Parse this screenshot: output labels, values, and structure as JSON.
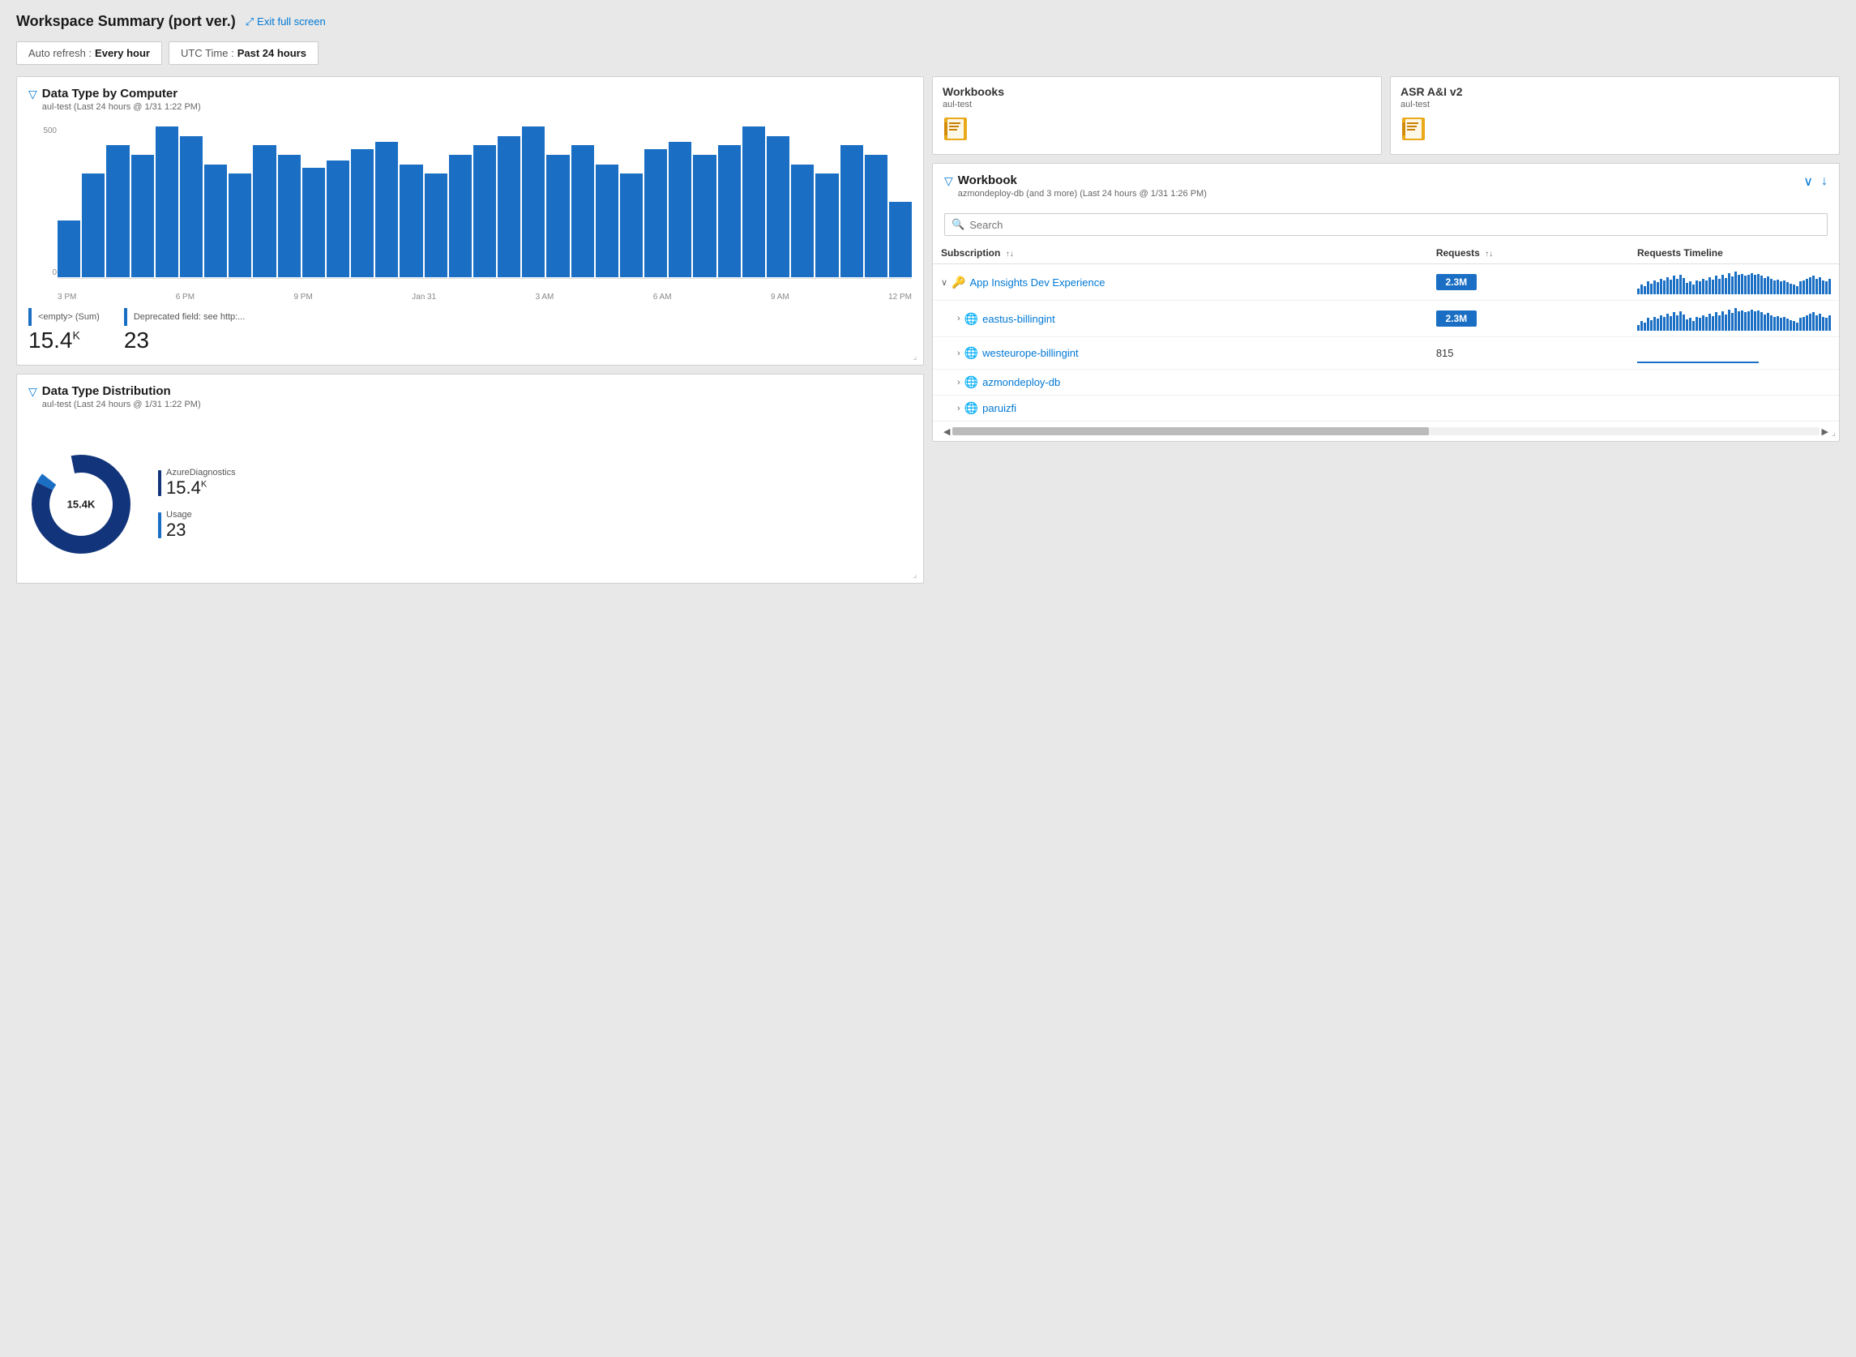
{
  "page": {
    "title": "Workspace Summary (port ver.)",
    "exit_fullscreen_label": "Exit full screen"
  },
  "toolbar": {
    "auto_refresh_label": "Auto refresh :",
    "auto_refresh_value": "Every hour",
    "time_label": "UTC Time :",
    "time_value": "Past 24 hours"
  },
  "data_type_by_computer": {
    "title": "Data Type by Computer",
    "subtitle": "aul-test (Last 24 hours @ 1/31 1:22 PM)",
    "y_labels": [
      "500",
      "0"
    ],
    "x_labels": [
      "3 PM",
      "6 PM",
      "9 PM",
      "Jan 31",
      "3 AM",
      "6 AM",
      "9 AM",
      "12 PM"
    ],
    "metric1_label": "<empty> (Sum)",
    "metric1_value": "15.4 K",
    "metric1_suffix": "K",
    "metric1_main": "15.4",
    "metric2_label": "Deprecated field: see http:...",
    "metric2_value": "23",
    "bar_heights": [
      30,
      55,
      70,
      65,
      80,
      75,
      60,
      55,
      70,
      65,
      58,
      62,
      68,
      72,
      60,
      55,
      65,
      70,
      75,
      80,
      65,
      70,
      60,
      55,
      68,
      72,
      65,
      70,
      80,
      75,
      60,
      55,
      70,
      65,
      40
    ]
  },
  "workbooks_list": [
    {
      "title": "Workbooks",
      "subtitle": "aul-test",
      "icon": "📒"
    },
    {
      "title": "ASR A&I v2",
      "subtitle": "aul-test",
      "icon": "📒"
    }
  ],
  "workbook_panel": {
    "title": "Workbook",
    "subtitle": "azmondeploy-db (and 3 more) (Last 24 hours @ 1/31 1:26 PM)",
    "search_placeholder": "Search",
    "columns": [
      {
        "label": "Subscription",
        "sortable": true
      },
      {
        "label": "Requests",
        "sortable": true
      },
      {
        "label": "Requests Timeline",
        "sortable": false
      }
    ],
    "rows": [
      {
        "indent": 0,
        "expand_icon": "chevron-down",
        "icon_type": "key",
        "name": "App Insights Dev Experience",
        "requests": "2.3M",
        "requests_highlighted": true,
        "has_sparkline": true,
        "sparkline_type": "bars"
      },
      {
        "indent": 1,
        "expand_icon": "chevron-right",
        "icon_type": "globe",
        "name": "eastus-billingint",
        "requests": "2.3M",
        "requests_highlighted": true,
        "has_sparkline": true,
        "sparkline_type": "bars"
      },
      {
        "indent": 1,
        "expand_icon": "chevron-right",
        "icon_type": "globe",
        "name": "westeurope-billingint",
        "requests": "815",
        "requests_highlighted": false,
        "has_sparkline": true,
        "sparkline_type": "line"
      },
      {
        "indent": 1,
        "expand_icon": "chevron-right",
        "icon_type": "globe",
        "name": "azmondeploy-db",
        "requests": "",
        "requests_highlighted": false,
        "has_sparkline": false,
        "sparkline_type": "none"
      },
      {
        "indent": 1,
        "expand_icon": "chevron-right",
        "icon_type": "globe",
        "name": "paruizfi",
        "requests": "",
        "requests_highlighted": false,
        "has_sparkline": false,
        "sparkline_type": "none"
      }
    ]
  },
  "data_type_distribution": {
    "title": "Data Type Distribution",
    "subtitle": "aul-test (Last 24 hours @ 1/31 1:22 PM)",
    "donut_center": "15.4K",
    "legend": [
      {
        "label": "AzureDiagnostics",
        "value": "15.4 K",
        "value_main": "15.4",
        "value_suffix": "K",
        "color": "#1a6fc4"
      },
      {
        "label": "Usage",
        "value": "23",
        "value_main": "23",
        "value_suffix": "",
        "color": "#1a6fc4"
      }
    ]
  },
  "icons": {
    "filter": "⊿",
    "exit_fullscreen": "⤢",
    "search": "🔍",
    "chevron_down": "∨",
    "chevron_right": "›",
    "sort": "↑↓",
    "globe": "🌐",
    "key": "🔑",
    "workbook": "📒",
    "download": "↓",
    "expand": "↗",
    "scroll_left": "◀",
    "scroll_right": "▶"
  }
}
